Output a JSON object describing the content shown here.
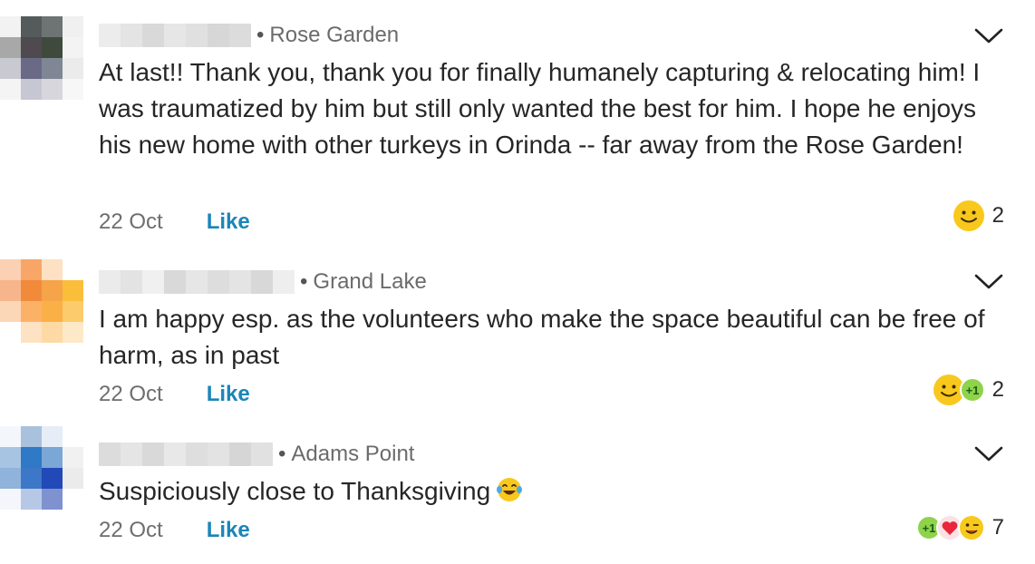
{
  "comments": [
    {
      "locality": "Rose Garden",
      "text": "At last!! Thank you, thank you for finally humanely capturing & relocating him! I was traumatized by him but still only wanted the best for him. I hope he enjoys his new home with other turkeys in Orinda -- far away from the Rose Garden!",
      "date": "22 Oct",
      "like_label": "Like",
      "reaction_count": "2",
      "reactions": [
        "smile-emoji"
      ],
      "avatar_colors": [
        "#f2f2f2",
        "#555a5a",
        "#6e7373",
        "#f0f0f0",
        "#a8a8a8",
        "#4f4a4f",
        "#3f4a3d",
        "#f3f3f3",
        "#c9c9d1",
        "#6b6a86",
        "#7f8794",
        "#ebebeb",
        "#f4f4f4",
        "#c7c7d3",
        "#d6d6dc",
        "#f7f7f7"
      ]
    },
    {
      "locality": "Grand Lake",
      "text": "I am happy esp. as the volunteers who make the space beautiful can be free of harm, as in past",
      "date": "22 Oct",
      "like_label": "Like",
      "reaction_count": "2",
      "reactions": [
        "smile-emoji",
        "plus-one-icon"
      ],
      "avatar_colors": [
        "#fcd0b2",
        "#f7a667",
        "#fde1c2",
        "#ffffff",
        "#f7b58c",
        "#f28a3c",
        "#f5a44a",
        "#fbbe3a",
        "#fbd7b8",
        "#fbb267",
        "#fbb047",
        "#fccb6b",
        "#ffffff",
        "#fde2c3",
        "#fdd9a4",
        "#fde9c7"
      ]
    },
    {
      "locality": "Adams Point",
      "text": "Suspiciously close to Thanksgiving",
      "inline_emoji": "laughing-tears-emoji",
      "date": "22 Oct",
      "like_label": "Like",
      "reaction_count": "7",
      "reactions": [
        "plus-one-icon",
        "heart-icon",
        "wink-emoji"
      ],
      "avatar_colors": [
        "#f3f6fb",
        "#aac1de",
        "#e6edf6",
        "#ffffff",
        "#a7c4e2",
        "#2f79c6",
        "#7aa7d6",
        "#f1f1f1",
        "#8fb3da",
        "#3d77c7",
        "#2249b8",
        "#ebebeb",
        "#f4f6fb",
        "#b7c8e6",
        "#7f92d0",
        "#ffffff"
      ]
    }
  ],
  "colors": {
    "like": "#1a86b8",
    "date": "#6e6e6e",
    "locality": "#6b6b6b",
    "emoji_yellow": "#f8c81c",
    "plus_one_green": "#8ed34a",
    "heart_red": "#e8273c"
  }
}
